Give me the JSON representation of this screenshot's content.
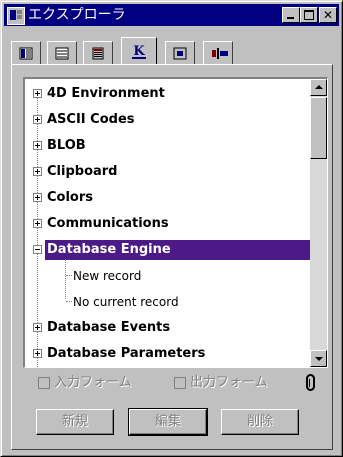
{
  "window": {
    "title": "エクスプローラ"
  },
  "tabs": [
    {
      "name": "tab-tables",
      "icon": "table-icon"
    },
    {
      "name": "tab-forms",
      "icon": "form-icon"
    },
    {
      "name": "tab-methods",
      "icon": "method-icon"
    },
    {
      "name": "tab-commands",
      "icon": "k-commands-icon",
      "label": "K",
      "active": true
    },
    {
      "name": "tab-pictures",
      "icon": "picture-icon"
    },
    {
      "name": "tab-subroutines",
      "icon": "plugin-icon"
    }
  ],
  "tree": {
    "items": [
      {
        "label": "4D Environment",
        "expanded": false
      },
      {
        "label": "ASCII Codes",
        "expanded": false
      },
      {
        "label": "BLOB",
        "expanded": false
      },
      {
        "label": "Clipboard",
        "expanded": false
      },
      {
        "label": "Colors",
        "expanded": false
      },
      {
        "label": "Communications",
        "expanded": false
      },
      {
        "label": "Database Engine",
        "expanded": true,
        "selected": true
      },
      {
        "label": "New record",
        "child": true
      },
      {
        "label": "No current record",
        "child": true
      },
      {
        "label": "Database Events",
        "expanded": false
      },
      {
        "label": "Database Parameters",
        "expanded": false
      }
    ],
    "selection_color": "#4b1a86"
  },
  "options": {
    "input_form_label": "入力フォーム",
    "output_form_label": "出力フォーム"
  },
  "buttons": {
    "new_label": "新規",
    "edit_label": "編集",
    "delete_label": "削除"
  }
}
